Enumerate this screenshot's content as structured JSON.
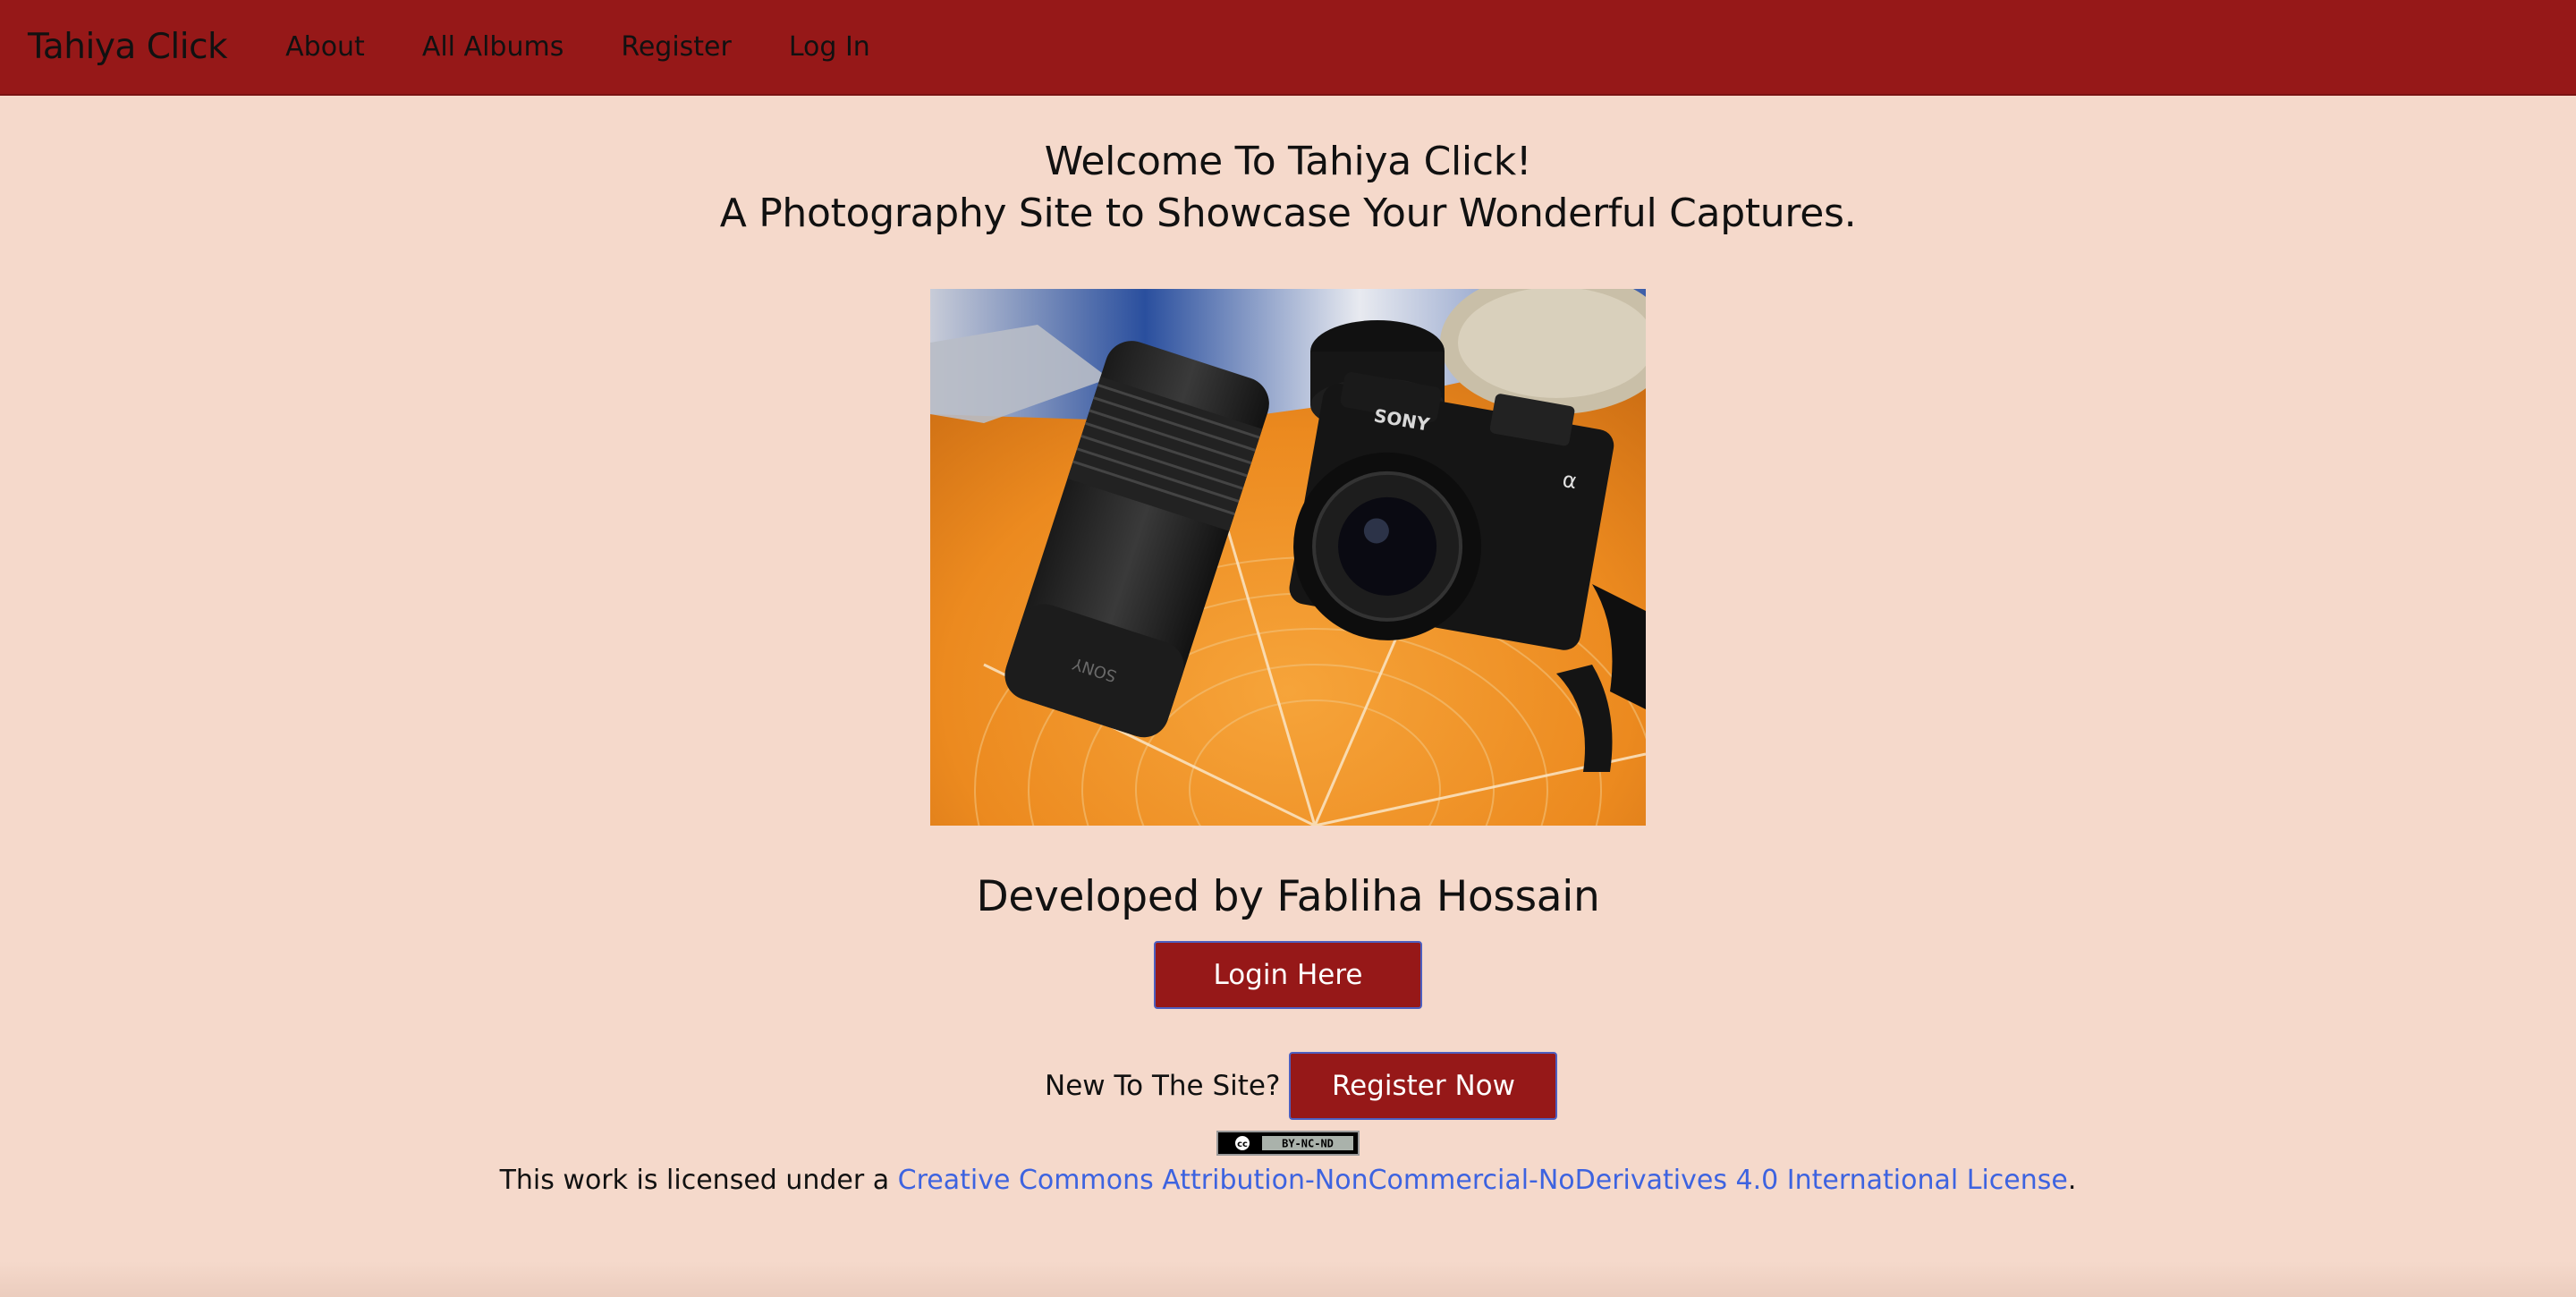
{
  "nav": {
    "brand": "Tahiya Click",
    "links": [
      "About",
      "All Albums",
      "Register",
      "Log In"
    ]
  },
  "welcome": {
    "line1": "Welcome To Tahiya Click!",
    "line2": "A Photography Site to Showcase Your Wonderful Captures."
  },
  "hero": {
    "camera_text": "SONY",
    "lens_text": "SONY"
  },
  "developer": "Developed by Fabliha Hossain",
  "login_button": "Login Here",
  "register": {
    "question": "New To The Site?",
    "button": "Register Now"
  },
  "cc_badge": {
    "cc": "cc",
    "terms": "BY-NC-ND"
  },
  "license": {
    "prefix": "This work is licensed under a ",
    "link": "Creative Commons Attribution-NonCommercial-NoDerivatives 4.0 International License",
    "suffix": "."
  },
  "colors": {
    "nav_bg": "#961818",
    "page_bg": "#f5d9cb",
    "button_bg": "#961818",
    "button_border": "#4d5fc0",
    "link": "#3d63e0"
  }
}
